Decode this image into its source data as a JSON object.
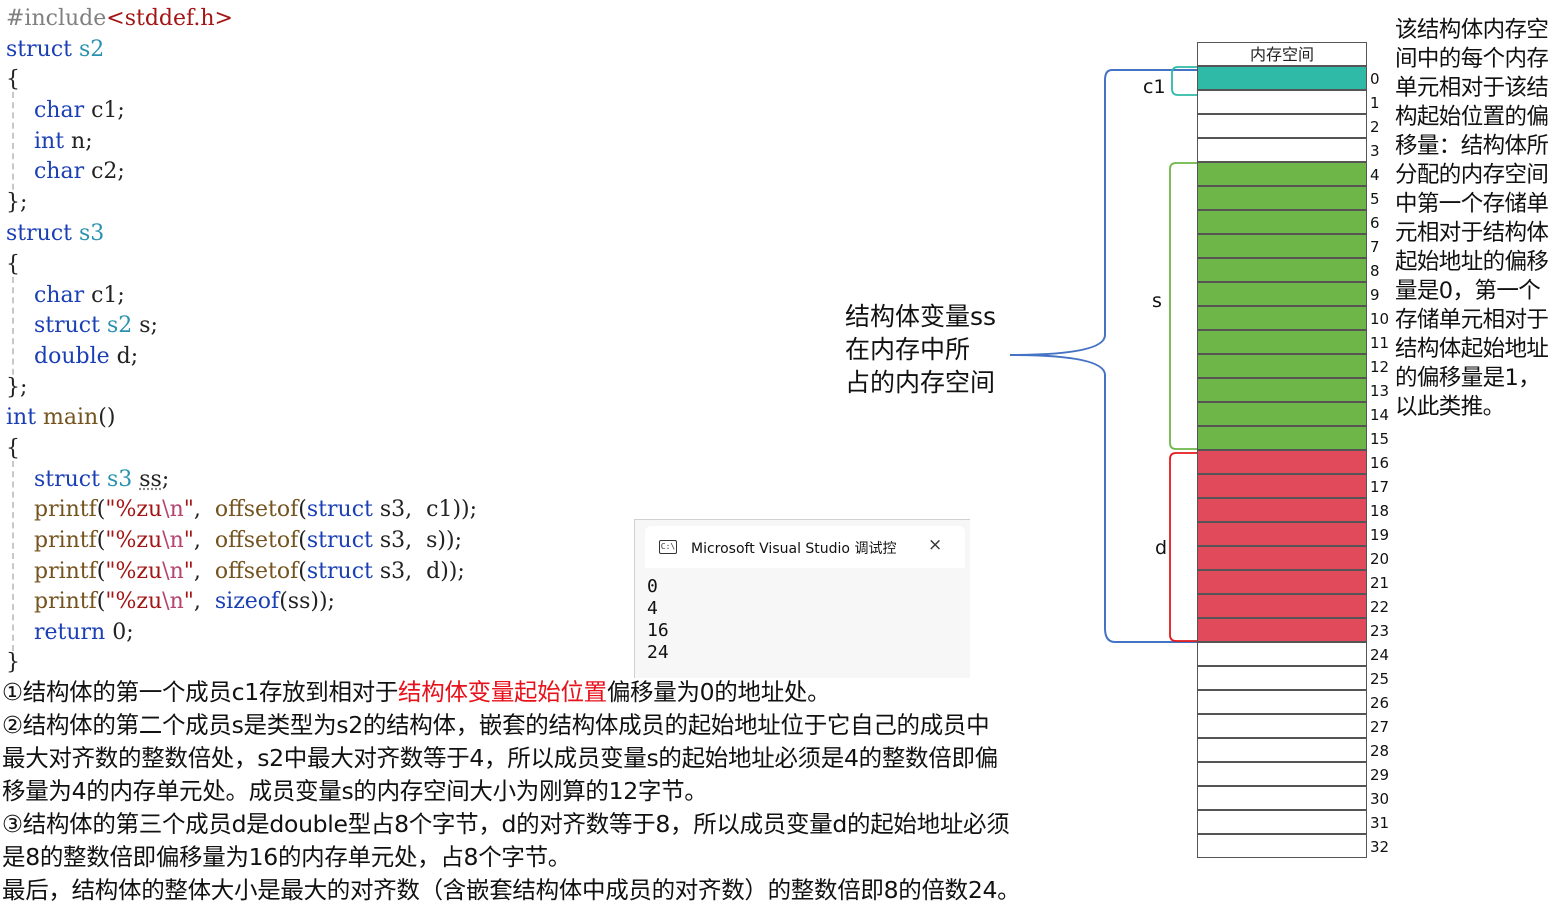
{
  "code": {
    "include_directive": "#include",
    "include_header": "<stddef.h>",
    "struct_s2": {
      "keyword": "struct",
      "name": "s2",
      "open": "{",
      "close": "};",
      "members": [
        {
          "type": "char",
          "name": "c1;"
        },
        {
          "type": "int",
          "name": "n;"
        },
        {
          "type": "char",
          "name": "c2;"
        }
      ]
    },
    "struct_s3": {
      "keyword": "struct",
      "name": "s3",
      "open": "{",
      "close": "};",
      "members": [
        {
          "type": "char",
          "name": "c1;"
        },
        {
          "type": "struct",
          "type2": "s2",
          "name": "s;"
        },
        {
          "type": "double",
          "name": "d;"
        }
      ]
    },
    "main": {
      "ret_type": "int",
      "name": "main",
      "parens": "()",
      "open": "{",
      "close": "}",
      "decl": {
        "kw": "struct",
        "type": "s3",
        "var": "ss",
        "end": ";"
      },
      "printf_lines": [
        {
          "fn": "printf",
          "fmt": "\"%zu",
          "esc": "\\n",
          "q": "\"",
          "call": "offsetof",
          "kw": "struct",
          "args": " s3,  c1));"
        },
        {
          "fn": "printf",
          "fmt": "\"%zu",
          "esc": "\\n",
          "q": "\"",
          "call": "offsetof",
          "kw": "struct",
          "args": " s3,  s));"
        },
        {
          "fn": "printf",
          "fmt": "\"%zu",
          "esc": "\\n",
          "q": "\"",
          "call": "offsetof",
          "kw": "struct",
          "args": " s3,  d));"
        }
      ],
      "sizeof_line": {
        "fn": "printf",
        "fmt": "\"%zu",
        "esc": "\\n",
        "q": "\"",
        "call": "sizeof",
        "args": "(ss));"
      },
      "return_line": {
        "kw": "return",
        "val": " 0;"
      }
    }
  },
  "console": {
    "title": "Microsoft Visual Studio 调试控",
    "icon_text": "C:\\",
    "close_glyph": "×",
    "output": [
      "0",
      "4",
      "16",
      "24"
    ]
  },
  "notes": {
    "line1_a": "①结构体的第一个成员c1存放到相对于",
    "line1_hl": "结构体变量起始位置",
    "line1_b": "偏移量为0的地址处。",
    "line2": "②结构体的第二个成员s是类型为s2的结构体，嵌套的结构体成员的起始地址位于它自己的成员中",
    "line3": "最大对齐数的整数倍处，s2中最大对齐数等于4，所以成员变量s的起始地址必须是4的整数倍即偏",
    "line4": "移量为4的内存单元处。成员变量s的内存空间大小为刚算的12字节。",
    "line5": "③结构体的第三个成员d是double型占8个字节，d的对齐数等于8，所以成员变量d的起始地址必须",
    "line6": "是8的整数倍即偏移量为16的内存单元处，占8个字节。",
    "line7": "最后，结构体的整体大小是最大的对齐数（含嵌套结构体中成员的对齐数）的整数倍即8的倍数24。"
  },
  "ss_label": [
    "结构体变量ss",
    "在内存中所",
    "占的内存空间"
  ],
  "side_text": [
    "该结构体内存空",
    "间中的每个内存",
    "单元相对于该结",
    "构起始位置的偏",
    "移量：结构体所",
    "分配的内存空间",
    "中第一个存储单",
    "元相对于结构体",
    "起始地址的偏移",
    "量是0，第一个",
    "存储单元相对于",
    "结构体起始地址",
    "的偏移量是1，",
    "以此类推。"
  ],
  "memory": {
    "header": "内存空间",
    "indices": [
      "0",
      "1",
      "2",
      "3",
      "4",
      "5",
      "6",
      "7",
      "8",
      "9",
      "10",
      "11",
      "12",
      "13",
      "14",
      "15",
      "16",
      "17",
      "18",
      "19",
      "20",
      "21",
      "22",
      "23",
      "24",
      "25",
      "26",
      "27",
      "28",
      "29",
      "30",
      "31",
      "32"
    ],
    "member_labels": {
      "c1": "c1",
      "s": "s",
      "d": "d"
    },
    "colors": {
      "c1": "#2ebaa7",
      "s": "#6fb648",
      "d": "#e04a5a",
      "empty": "#ffffff",
      "brace_ss": "#4472c4",
      "brace_c1": "#2ebaa7",
      "brace_s": "#6fb648",
      "brace_d": "#e31a1c"
    },
    "fill": [
      "c1",
      "empty",
      "empty",
      "empty",
      "s",
      "s",
      "s",
      "s",
      "s",
      "s",
      "s",
      "s",
      "s",
      "s",
      "s",
      "s",
      "d",
      "d",
      "d",
      "d",
      "d",
      "d",
      "d",
      "d",
      "empty",
      "empty",
      "empty",
      "empty",
      "empty",
      "empty",
      "empty",
      "empty",
      "empty"
    ]
  }
}
